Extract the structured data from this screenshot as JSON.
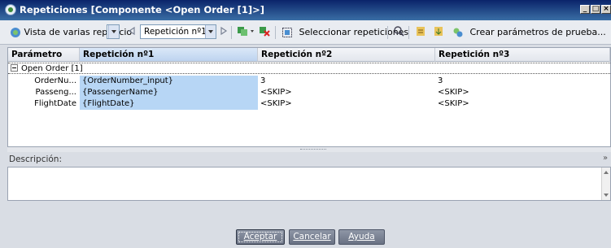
{
  "window": {
    "title": "Repeticiones [Componente <Open Order [1]>]"
  },
  "toolbar": {
    "view_label": "Vista de varias repeticio",
    "repetition_combo_value": "Repetición nº1",
    "select_repetitions_label": "Seleccionar repeticiones",
    "create_params_label": "Crear parámetros de prueba..."
  },
  "grid": {
    "headers": [
      "Parámetro",
      "Repetición nº1",
      "Repetición nº2",
      "Repetición nº3"
    ],
    "group_label": "Open Order [1]",
    "rows": [
      {
        "param": "OrderNu...",
        "rep1": "{OrderNumber_input}",
        "rep2": "3",
        "rep3": "3"
      },
      {
        "param": "Passeng...",
        "rep1": "{PassengerName}",
        "rep2": "<SKIP>",
        "rep3": "<SKIP>"
      },
      {
        "param": "FlightDate",
        "rep1": "{FlightDate}",
        "rep2": "<SKIP>",
        "rep3": "<SKIP>"
      }
    ]
  },
  "description": {
    "label": "Descripción:",
    "value": ""
  },
  "footer": {
    "accept_label": "Aceptar",
    "cancel_label": "Cancelar",
    "help_label": "Ayuda"
  },
  "colors": {
    "titlebar": "#0a246a",
    "selection": "#b7d6f5",
    "button": "#7a8294"
  },
  "icons": [
    "app-icon",
    "view-icon",
    "prev-arrow-icon",
    "next-arrow-icon",
    "add-repetition-icon",
    "delete-repetition-icon",
    "select-repetitions-icon",
    "search-icon",
    "import-icon",
    "export-icon",
    "create-params-icon",
    "minimize-icon",
    "maximize-icon",
    "close-icon"
  ]
}
